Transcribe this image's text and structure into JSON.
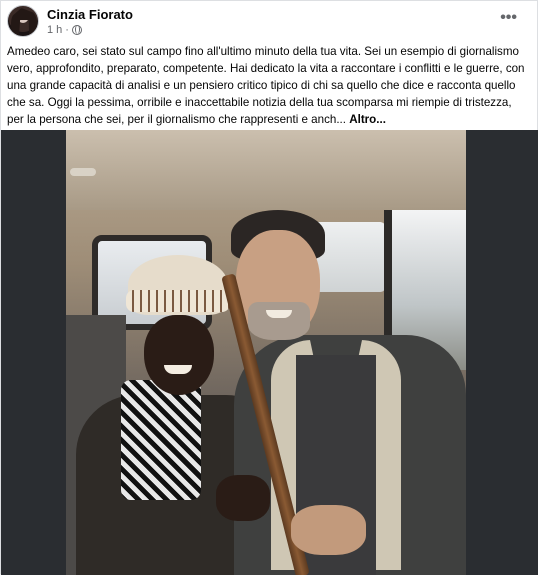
{
  "post": {
    "author": "Cinzia Fiorato",
    "time": "1 h",
    "audience_icon": "globe-icon",
    "more_icon": "more-options-icon",
    "text": "Amedeo caro, sei stato sul campo fino all'ultimo minuto della tua vita. Sei un esempio di giornalismo vero, approfondito, preparato, competente. Hai dedicato la vita a raccontare i conflitti e le guerre, con una grande capacità di analisi e un pensiero critico tipico di chi sa quello che dice e racconta quello che sa. Oggi la pessima, orribile e inaccettabile notizia della tua scomparsa mi riempie di tristezza, per la persona che sei, per il giornalismo che rappresenti e anch...",
    "see_more": "Altro..."
  },
  "colors": {
    "text": "#050505",
    "secondary": "#65676b",
    "photo_backdrop": "#2a2d31"
  }
}
